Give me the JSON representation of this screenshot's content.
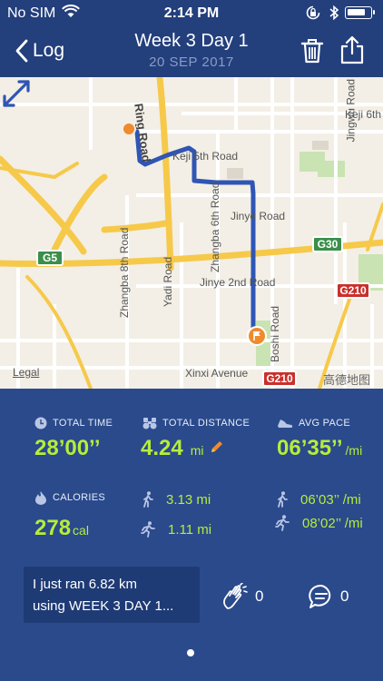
{
  "status_bar": {
    "carrier": "No SIM",
    "time": "2:14 PM"
  },
  "nav": {
    "back_label": "Log",
    "title": "Week 3 Day 1",
    "subtitle": "20 SEP 2017"
  },
  "map": {
    "road_labels": {
      "ring_road": "Ring Road",
      "jingwu_road": "Jingwu Road",
      "keji_6th_top": "Keji 6th",
      "keji_5th_road": "Keji 5th Road",
      "zhangba_6th_road": "Zhangba 6th Road",
      "jinye_road": "Jinye Road",
      "zhangba_8th_road": "Zhangba 8th Road",
      "yadi_road": "Yadi Road",
      "jinye_2nd_road": "Jinye 2nd Road",
      "boshi_road": "Boshi Road",
      "xinxi_avenue": "Xinxi Avenue"
    },
    "shields": {
      "g5": "G5",
      "g30": "G30",
      "g210_a": "G210",
      "g210_b": "G210"
    },
    "legal": "Legal",
    "brand": "高德地图",
    "colors": {
      "route": "#2f55b5",
      "marker": "#f08a2e",
      "highway": "#f6c94a"
    }
  },
  "stats": {
    "total_time": {
      "label": "TOTAL TIME",
      "value": "28’00’’"
    },
    "total_distance": {
      "label": "TOTAL DISTANCE",
      "value": "4.24",
      "unit": "mi"
    },
    "avg_pace": {
      "label": "AVG PACE",
      "value": "06’35’’",
      "unit": "/mi"
    },
    "calories": {
      "label": "CALORIES",
      "value": "278",
      "unit": "cal"
    },
    "walk_distance": "3.13 mi",
    "run_distance": "1.11 mi",
    "walk_pace": "06’03’’ /mi",
    "run_pace": "08’02’’ /mi"
  },
  "post": {
    "line1": "I just ran 6.82 km",
    "line2": "using WEEK 3 DAY 1..."
  },
  "social": {
    "high_fives": "0",
    "comments": "0"
  },
  "colors": {
    "accent": "#b7ed3a",
    "background": "#2a4a8c",
    "header": "#233f7c"
  }
}
